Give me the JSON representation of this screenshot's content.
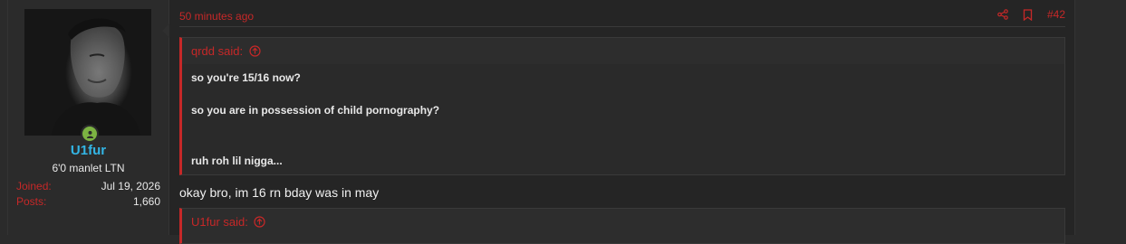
{
  "post": {
    "time": "50 minutes ago",
    "number": "#42",
    "user": {
      "name": "U1fur",
      "title": "6'0 manlet LTN",
      "joined_label": "Joined:",
      "joined_value": "Jul 19, 2026",
      "posts_label": "Posts:",
      "posts_value": "1,660",
      "online": true
    },
    "quotes": [
      {
        "author": "qrdd said:",
        "lines": [
          "so you're 15/16 now?",
          "so you are in possession of child pornography?",
          "ruh roh lil nigga..."
        ]
      },
      {
        "author": "U1fur said:"
      }
    ],
    "message": "okay bro, im 16 rn bday was in may"
  },
  "colors": {
    "accent": "#c62828",
    "username": "#33b5e5",
    "online": "#7cb342",
    "background": "#252525"
  },
  "icons": [
    "share-icon",
    "bookmark-icon",
    "arrow-up-circle-icon",
    "user-icon"
  ]
}
